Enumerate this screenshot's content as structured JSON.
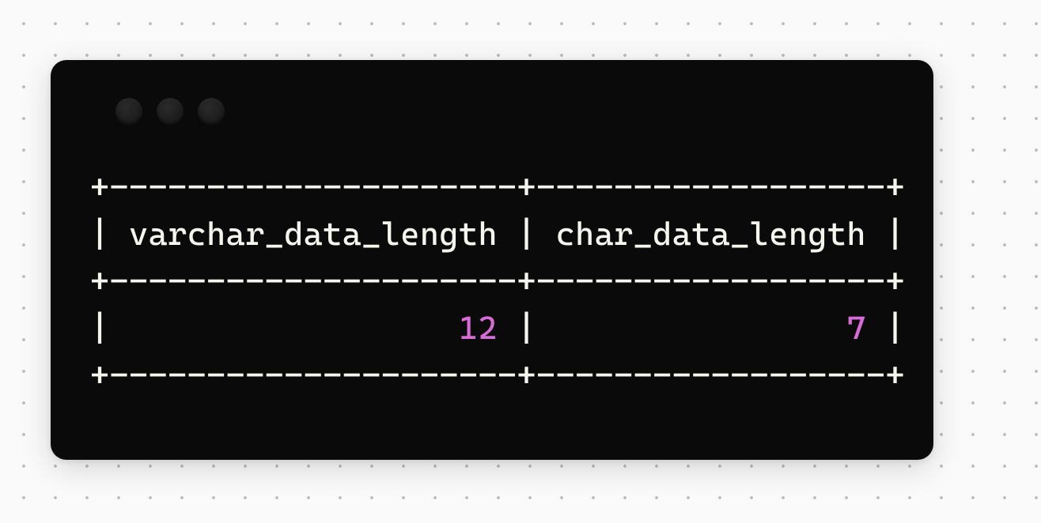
{
  "terminal": {
    "traffic_lights": {
      "icons": [
        "close-icon",
        "minimize-icon",
        "maximize-icon"
      ]
    },
    "table": {
      "border_top": "+---------------------+------------------+",
      "header_row": "| varchar_data_length | char_data_length |",
      "border_mid": "+---------------------+------------------+",
      "data_row_pre1": "|                  ",
      "val1": "12",
      "data_row_mid": " |                ",
      "val2": "7",
      "data_row_post": " |",
      "border_bot": "+---------------------+------------------+",
      "columns": [
        "varchar_data_length",
        "char_data_length"
      ],
      "values": [
        12,
        7
      ]
    },
    "colors": {
      "background": "#0a0a0a",
      "text": "#f5f5f0",
      "number": "#d96bd9"
    }
  }
}
